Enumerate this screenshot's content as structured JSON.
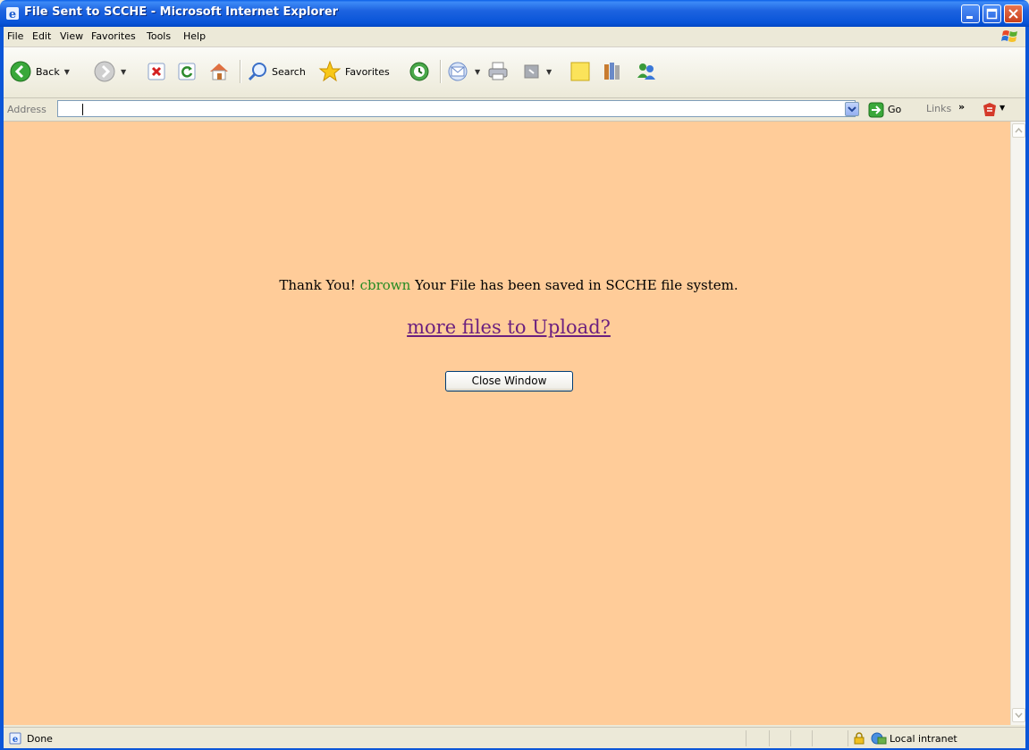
{
  "window": {
    "title": "File Sent to SCCHE - Microsoft Internet Explorer"
  },
  "menu": [
    "File",
    "Edit",
    "View",
    "Favorites",
    "Tools",
    "Help"
  ],
  "toolbar": {
    "back_label": "Back",
    "search_label": "Search",
    "favorites_label": "Favorites"
  },
  "address": {
    "label": "Address",
    "value": "",
    "go_label": "Go",
    "links_label": "Links"
  },
  "page": {
    "thanks_prefix": "Thank You!",
    "username": "cbrown",
    "thanks_suffix": "Your File has been saved in SCCHE file system.",
    "upload_link": "more files to Upload?",
    "close_button": "Close Window",
    "background_color": "#ffcc99",
    "username_color": "#228b22",
    "link_color": "#6b1f7f"
  },
  "status": {
    "text": "Done",
    "zone": "Local intranet"
  }
}
